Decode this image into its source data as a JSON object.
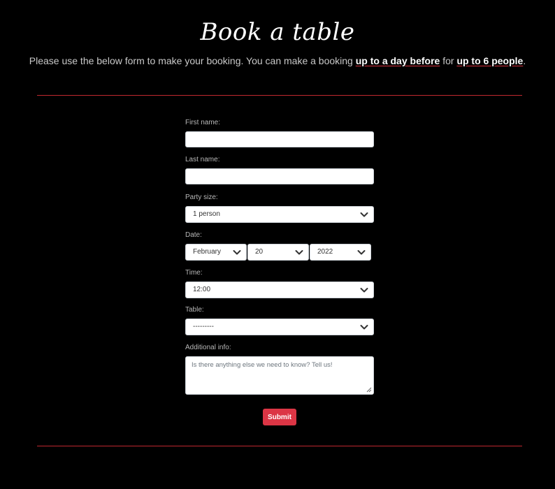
{
  "page": {
    "title": "Book a table",
    "intro": {
      "prefix": "Please use the below form to make your booking. You can make a booking ",
      "emphasis1": "up to a day before",
      "middle": " for ",
      "emphasis2": "up to 6 people",
      "suffix": "."
    }
  },
  "form": {
    "first_name": {
      "label": "First name:",
      "value": ""
    },
    "last_name": {
      "label": "Last name:",
      "value": ""
    },
    "party_size": {
      "label": "Party size:",
      "selected": "1 person"
    },
    "date": {
      "label": "Date:",
      "month": "February",
      "day": "20",
      "year": "2022"
    },
    "time": {
      "label": "Time:",
      "selected": "12:00"
    },
    "table": {
      "label": "Table:",
      "selected": "---------"
    },
    "additional_info": {
      "label": "Additional info:",
      "placeholder": "Is there anything else we need to know? Tell us!"
    },
    "submit_label": "Submit"
  },
  "colors": {
    "background": "#000000",
    "accent": "#dc3545",
    "rule": "#c0282f"
  }
}
